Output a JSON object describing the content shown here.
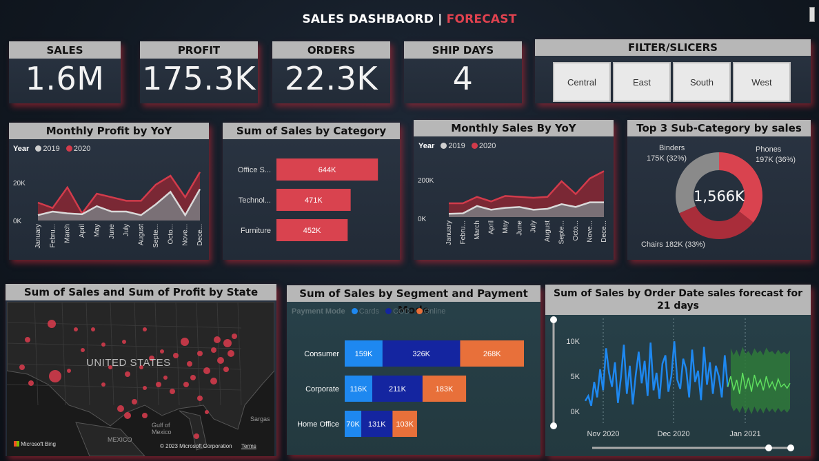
{
  "header": {
    "title_main": "SALES DASHBAORD |",
    "title_accent": "FORECAST"
  },
  "colors": {
    "accent": "#e0424f",
    "series_2019": "#cfcfcf",
    "series_2020": "#d23b4b",
    "cards": "#1e88f0",
    "cod": "#1425a0",
    "online": "#e8703a",
    "forecast": "#3fbf3f"
  },
  "kpis": [
    {
      "label": "SALES",
      "value": "1.6M"
    },
    {
      "label": "PROFIT",
      "value": "175.3K"
    },
    {
      "label": "ORDERS",
      "value": "22.3K"
    },
    {
      "label": "SHIP DAYS",
      "value": "4"
    }
  ],
  "filter": {
    "title": "FILTER/SLICERS",
    "options": [
      "Central",
      "East",
      "South",
      "West"
    ]
  },
  "months": [
    "January",
    "Febru...",
    "March",
    "April",
    "May",
    "June",
    "July",
    "August",
    "Septe...",
    "Octo...",
    "Nove...",
    "Dece..."
  ],
  "months_b": [
    "January",
    "Febru...",
    "March",
    "April",
    "May",
    "June",
    "July",
    "August",
    "Septe...",
    "Octo...",
    "Nove...",
    "Dece..."
  ],
  "chart_data": [
    {
      "type": "area",
      "title": "Monthly Profit by YoY",
      "legend_title": "Year",
      "series": [
        {
          "name": "2019",
          "values": [
            3000,
            5000,
            4000,
            3500,
            8000,
            5000,
            5000,
            3000,
            9000,
            16000,
            3000,
            17500
          ]
        },
        {
          "name": "2020",
          "values": [
            10000,
            7000,
            18500,
            4000,
            15000,
            13000,
            11000,
            11000,
            20000,
            25000,
            13000,
            27000
          ]
        }
      ],
      "yticks": [
        "0K",
        "20K"
      ],
      "ylim": [
        0,
        30000
      ]
    },
    {
      "type": "bar",
      "title": "Sum of Sales by Category",
      "categories": [
        "Office S...",
        "Technol...",
        "Furniture"
      ],
      "values": [
        644,
        471,
        452
      ],
      "labels": [
        "644K",
        "471K",
        "452K"
      ]
    },
    {
      "type": "area",
      "title": "Monthly Sales By YoY",
      "legend_title": "Year",
      "series": [
        {
          "name": "2019",
          "values": [
            18000,
            20000,
            60000,
            40000,
            50000,
            55000,
            40000,
            45000,
            70000,
            55000,
            80000,
            80000
          ]
        },
        {
          "name": "2020",
          "values": [
            75000,
            75000,
            110000,
            85000,
            115000,
            110000,
            105000,
            110000,
            195000,
            125000,
            210000,
            250000
          ]
        }
      ],
      "yticks": [
        "0K",
        "200K"
      ],
      "ylim": [
        0,
        270000
      ]
    },
    {
      "type": "pie",
      "title": "Top 3 Sub-Category by sales",
      "center_label": "1,566K",
      "slices": [
        {
          "name": "Phones",
          "value": 197,
          "label": "Phones",
          "sub": "197K (36%)"
        },
        {
          "name": "Chairs",
          "value": 182,
          "label": "Chairs 182K (33%)",
          "sub": ""
        },
        {
          "name": "Binders",
          "value": 175,
          "label": "Binders",
          "sub": "175K (32%)"
        }
      ]
    },
    {
      "type": "bar",
      "title": "Sum of Sales by Segment and Payment Mode",
      "legend_title": "Payment Mode",
      "categories": [
        "Consumer",
        "Corporate",
        "Home Office"
      ],
      "series": [
        {
          "name": "Cards",
          "values": [
            159,
            116,
            70
          ],
          "labels": [
            "159K",
            "116K",
            "70K"
          ]
        },
        {
          "name": "COD",
          "values": [
            326,
            211,
            131
          ],
          "labels": [
            "326K",
            "211K",
            "131K"
          ]
        },
        {
          "name": "Online",
          "values": [
            268,
            183,
            103
          ],
          "labels": [
            "268K",
            "183K",
            "103K"
          ]
        }
      ]
    },
    {
      "type": "line",
      "title": "Sum of Sales by Order Date sales forecast for 21 days",
      "xticks": [
        "Nov 2020",
        "Dec 2020",
        "Jan 2021"
      ],
      "yticks": [
        "0K",
        "5K",
        "10K"
      ],
      "ylim": [
        0,
        11000
      ],
      "values": [
        1500,
        2200,
        800,
        4200,
        2000,
        6000,
        3000,
        9000,
        5500,
        3500,
        7000,
        1200,
        4800,
        9500,
        2500,
        6500,
        1000,
        5200,
        8500,
        4000,
        7200,
        2200,
        9800,
        3000,
        5500,
        1800,
        6800,
        8000,
        2800,
        5000,
        10000,
        4500,
        3200,
        7500,
        6000,
        2000,
        8800,
        4200,
        5800,
        1600,
        9200,
        3800,
        7000,
        2500,
        6500,
        5000,
        2000,
        8000,
        3500
      ],
      "forecast": [
        5000,
        3000,
        4500,
        2500,
        5500,
        3200,
        4800,
        2800,
        5200,
        3600,
        4500,
        3000,
        5000,
        3400,
        4200,
        3100,
        4600,
        3500,
        3900,
        3300,
        4000
      ],
      "forecast_upper": [
        9000,
        8000,
        8800,
        7800,
        9200,
        8200,
        8600,
        7900,
        9000,
        8300,
        8700,
        8000,
        9100,
        8400,
        8600,
        8100,
        8800,
        8200,
        8500,
        8100,
        8700
      ],
      "forecast_lower": [
        1000,
        0,
        500,
        -200,
        800,
        -300,
        600,
        -400,
        700,
        -200,
        500,
        -300,
        600,
        -100,
        400,
        -200,
        500,
        -100,
        300,
        -200,
        400
      ]
    }
  ],
  "map": {
    "title": "Sum of Sales and Sum of Profit by State",
    "country": "UNITED STATES",
    "gulf": "Gulf of\nMexico",
    "mexico": "MEXICO",
    "sargasso": "Sargas",
    "bing": "Microsoft Bing",
    "copyright": "© 2023 Microsoft Corporation",
    "terms": "Terms"
  }
}
